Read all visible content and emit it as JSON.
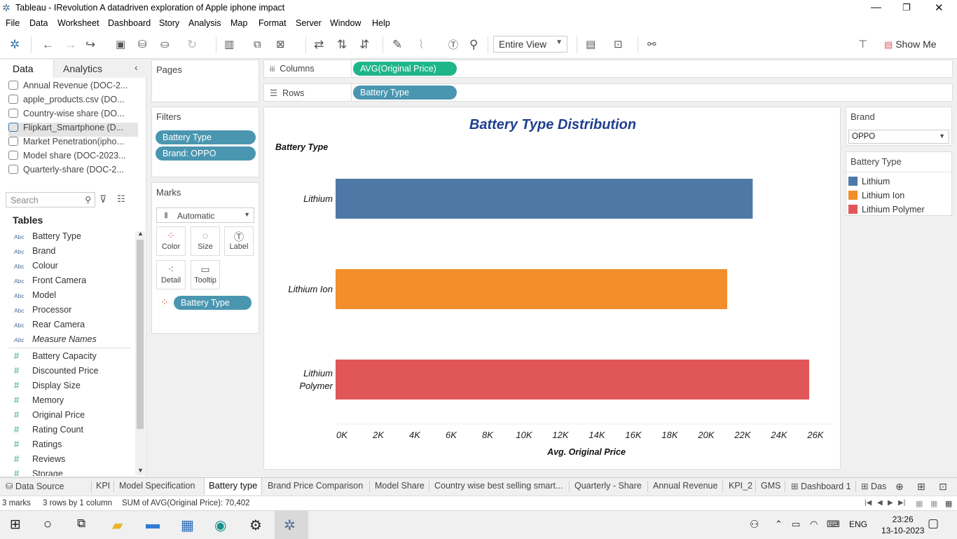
{
  "window": {
    "title": "Tableau - IRevolution A datadriven exploration of Apple iphone impact"
  },
  "menu": [
    "File",
    "Data",
    "Worksheet",
    "Dashboard",
    "Story",
    "Analysis",
    "Map",
    "Format",
    "Server",
    "Window",
    "Help"
  ],
  "toolbar": {
    "fit_value": "Entire View",
    "show_me_label": "Show Me"
  },
  "left_pane": {
    "tabs": [
      "Data",
      "Analytics"
    ],
    "datasources": [
      "Annual Revenue (DOC-2...",
      "apple_products.csv (DO...",
      "Country-wise share (DO...",
      "Flipkart_Smartphone (D...",
      "Market Penetration(ipho...",
      "Model share (DOC-2023...",
      "Quarterly-share (DOC-2..."
    ],
    "selected_datasource_index": 3,
    "search_placeholder": "Search",
    "tables_header": "Tables",
    "dimensions": [
      {
        "type": "Abc",
        "name": "Battery Type"
      },
      {
        "type": "Abc",
        "name": "Brand"
      },
      {
        "type": "Abc",
        "name": "Colour"
      },
      {
        "type": "Abc",
        "name": "Front Camera"
      },
      {
        "type": "Abc",
        "name": "Model"
      },
      {
        "type": "Abc",
        "name": "Processor"
      },
      {
        "type": "Abc",
        "name": "Rear Camera"
      },
      {
        "type": "Abc",
        "name": "Measure Names"
      }
    ],
    "measures": [
      "Battery Capacity",
      "Discounted Price",
      "Display Size",
      "Memory",
      "Original Price",
      "Rating Count",
      "Ratings",
      "Reviews",
      "Storage"
    ]
  },
  "pages_label": "Pages",
  "filters": {
    "label": "Filters",
    "items": [
      "Battery Type",
      "Brand: OPPO"
    ]
  },
  "marks": {
    "label": "Marks",
    "type": "Automatic",
    "buttons": [
      "Color",
      "Size",
      "Label",
      "Detail",
      "Tooltip"
    ],
    "color_field": "Battery Type"
  },
  "shelves": {
    "columns_label": "Columns",
    "columns_pill": "AVG(Original Price)",
    "rows_label": "Rows",
    "rows_pill": "Battery Type"
  },
  "chart_data": {
    "type": "bar",
    "orientation": "horizontal",
    "title": "Battery Type Distribution",
    "row_header": "Battery Type",
    "categories": [
      "Lithium",
      "Lithium Ion",
      "Lithium Polymer"
    ],
    "values": [
      22900,
      21500,
      26000
    ],
    "colors": [
      "#4e79a7",
      "#f28e2b",
      "#e15759"
    ],
    "xlabel": "Avg. Original Price",
    "xlim": [
      0,
      26000
    ],
    "xticks": [
      "0K",
      "2K",
      "4K",
      "6K",
      "8K",
      "10K",
      "12K",
      "14K",
      "16K",
      "18K",
      "20K",
      "22K",
      "24K",
      "26K"
    ],
    "grid": false
  },
  "right_pane": {
    "brand_filter": {
      "label": "Brand",
      "value": "OPPO"
    },
    "legend": {
      "label": "Battery Type",
      "items": [
        {
          "name": "Lithium",
          "color": "#4e79a7"
        },
        {
          "name": "Lithium Ion",
          "color": "#f28e2b"
        },
        {
          "name": "Lithium Polymer",
          "color": "#e15759"
        }
      ]
    }
  },
  "sheet_tabs": {
    "data_source": "Data Source",
    "tabs": [
      "KPI",
      "Model Specification",
      "Battery type",
      "Brand Price Comparison",
      "Model Share",
      "Country wise best selling smart...",
      "Quarterly - Share",
      "Annual Revenue",
      "KPI_2",
      "GMS",
      "Dashboard 1",
      "Das"
    ],
    "active_index": 2
  },
  "status": {
    "marks": "3 marks",
    "dims": "3 rows by 1 column",
    "sum": "SUM of AVG(Original Price): 70,402"
  },
  "taskbar": {
    "time": "23:26",
    "date": "13-10-2023",
    "lang": "ENG"
  }
}
